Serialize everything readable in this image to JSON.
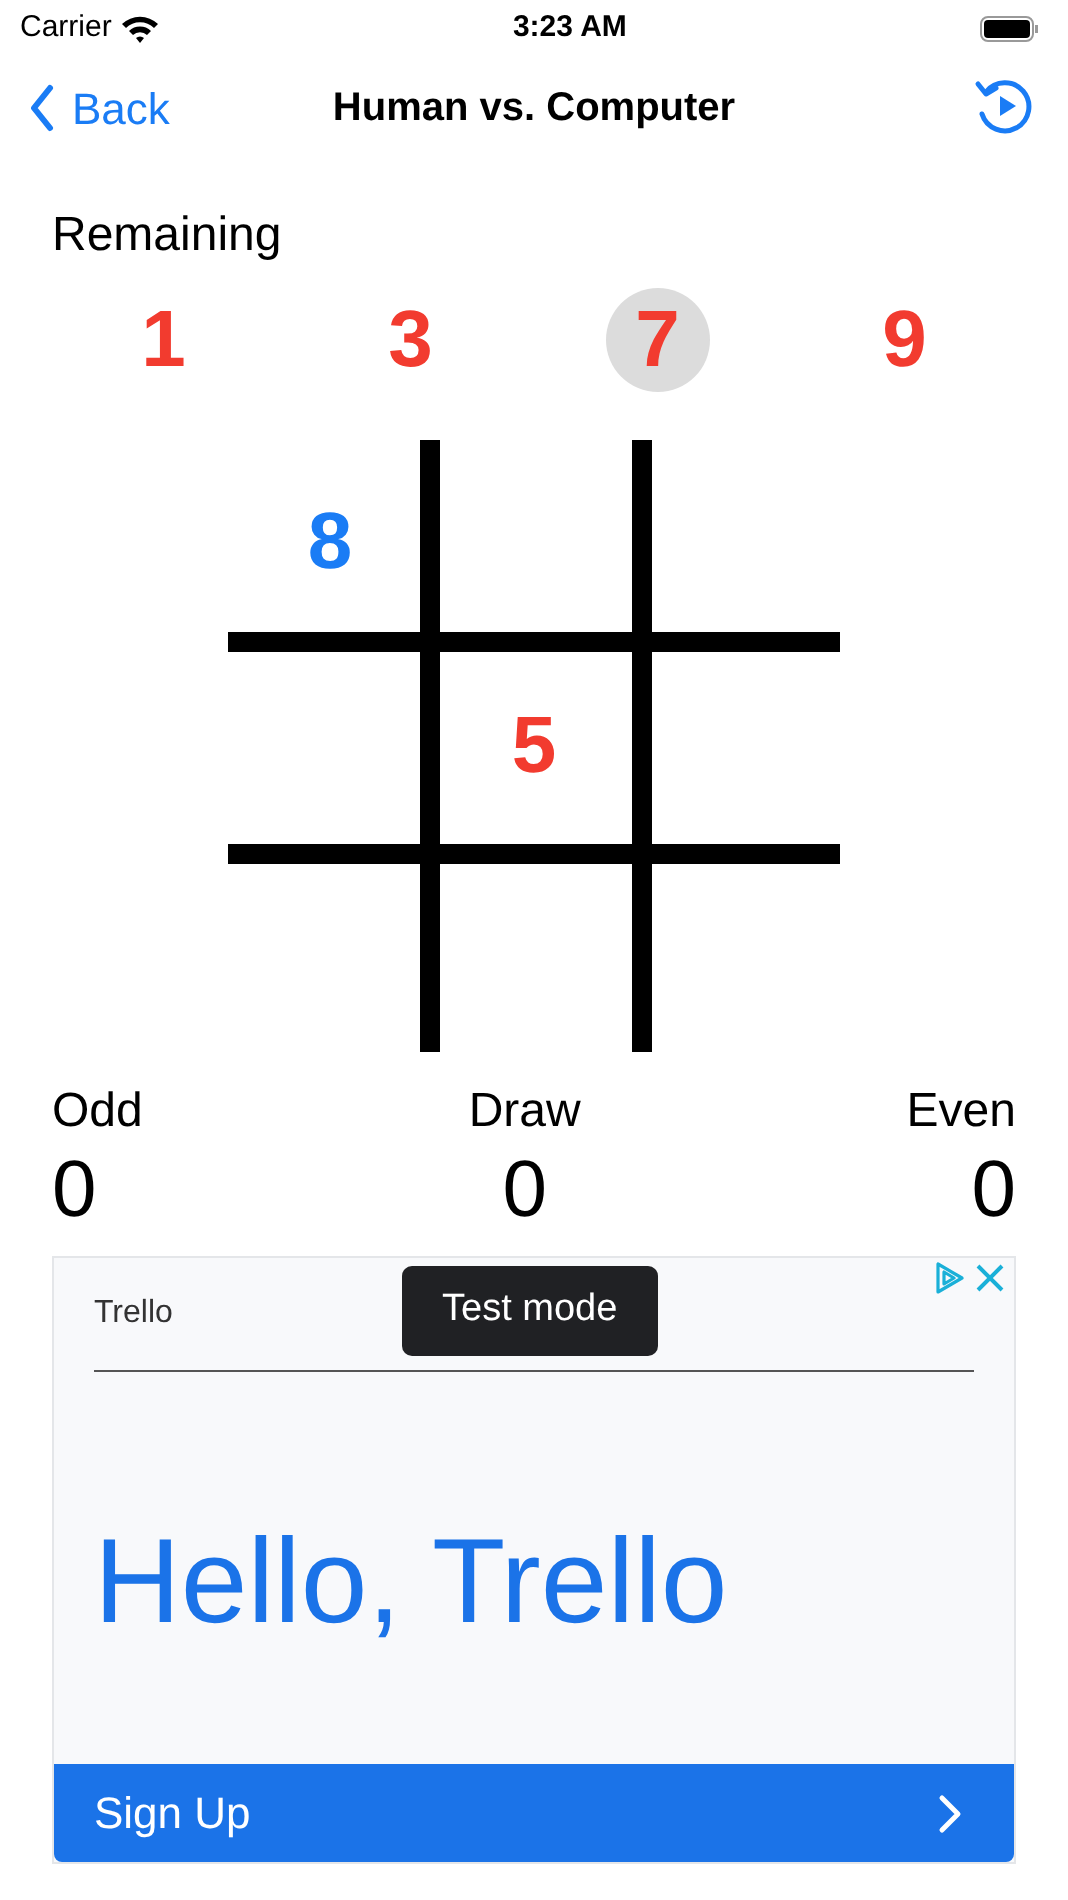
{
  "status_bar": {
    "carrier": "Carrier",
    "time": "3:23 AM"
  },
  "nav": {
    "back": "Back",
    "title": "Human vs. Computer"
  },
  "remaining": {
    "label": "Remaining",
    "numbers": [
      {
        "value": "1",
        "selected": false
      },
      {
        "value": "3",
        "selected": false
      },
      {
        "value": "7",
        "selected": true
      },
      {
        "value": "9",
        "selected": false
      }
    ]
  },
  "board": {
    "cells": [
      {
        "value": "8",
        "kind": "even"
      },
      {
        "kind": "empty"
      },
      {
        "kind": "empty"
      },
      {
        "kind": "empty"
      },
      {
        "value": "5",
        "kind": "odd"
      },
      {
        "kind": "empty"
      },
      {
        "kind": "empty"
      },
      {
        "kind": "empty"
      },
      {
        "kind": "empty"
      }
    ]
  },
  "scores": [
    {
      "label": "Odd",
      "value": "0"
    },
    {
      "label": "Draw",
      "value": "0"
    },
    {
      "label": "Even",
      "value": "0"
    }
  ],
  "ad": {
    "advertiser": "Trello",
    "tooltip": "Test mode",
    "headline": "Hello, Trello",
    "cta": "Sign Up"
  }
}
